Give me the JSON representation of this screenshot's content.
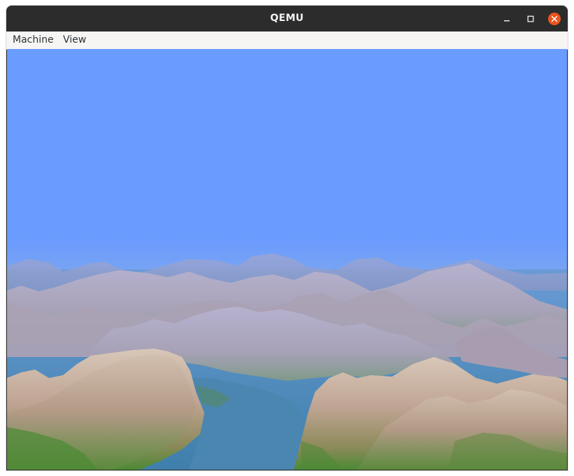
{
  "window": {
    "title": "QEMU"
  },
  "titlebar_buttons": {
    "minimize_icon": "minimize-icon",
    "maximize_icon": "maximize-icon",
    "close_icon": "close-icon",
    "close_color": "#e95420"
  },
  "menubar": {
    "items": [
      {
        "label": "Machine"
      },
      {
        "label": "View"
      }
    ]
  },
  "display": {
    "scene": "terrain-flyover",
    "sky_color": "#6a9bff",
    "water_color": "#4a86b0",
    "rock_color": "#bfa896",
    "grass_color": "#4c8a35"
  }
}
